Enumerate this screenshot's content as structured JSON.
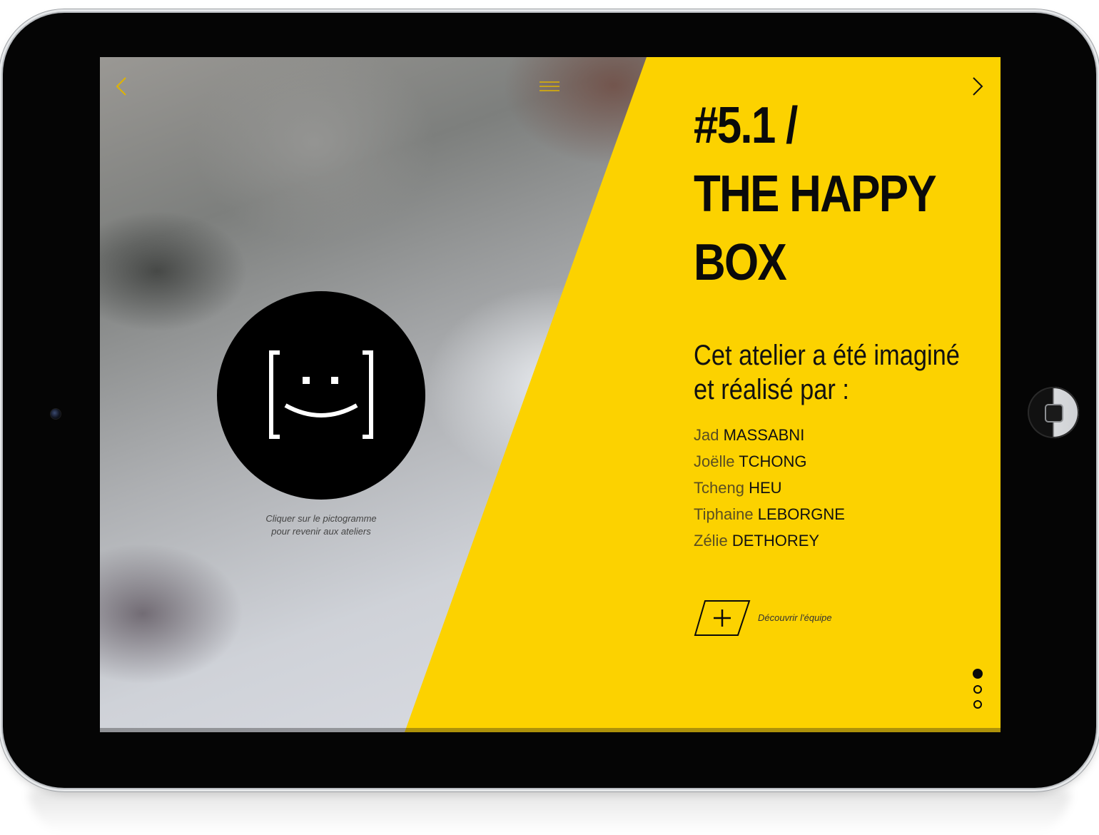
{
  "colors": {
    "accent": "#fcd200",
    "nav_icon": "#e0b400",
    "text": "#0a0a0a"
  },
  "nav": {
    "prev_icon": "chevron-left-icon",
    "menu_icon": "hamburger-menu-icon",
    "next_icon": "chevron-right-icon"
  },
  "left": {
    "pictogram_icon": "bracket-smiley-icon",
    "hint_line1": "Cliquer sur le pictogramme",
    "hint_line2": "pour revenir aux ateliers"
  },
  "main": {
    "title_line1": "#5.1 /",
    "title_line2": "THE HAPPY",
    "title_line3": "BOX",
    "intro_line1": "Cet atelier a été imaginé",
    "intro_line2": "et réalisé par :",
    "members": [
      {
        "first": "Jad",
        "last": "MASSABNI"
      },
      {
        "first": "Joëlle",
        "last": "TCHONG"
      },
      {
        "first": "Tcheng",
        "last": "HEU"
      },
      {
        "first": "Tiphaine",
        "last": "LEBORGNE"
      },
      {
        "first": "Zélie",
        "last": "DETHOREY"
      }
    ],
    "team_button_icon": "plus-icon",
    "team_link": "Découvrir l'équipe"
  },
  "pagination": {
    "total": 3,
    "current": 1
  }
}
